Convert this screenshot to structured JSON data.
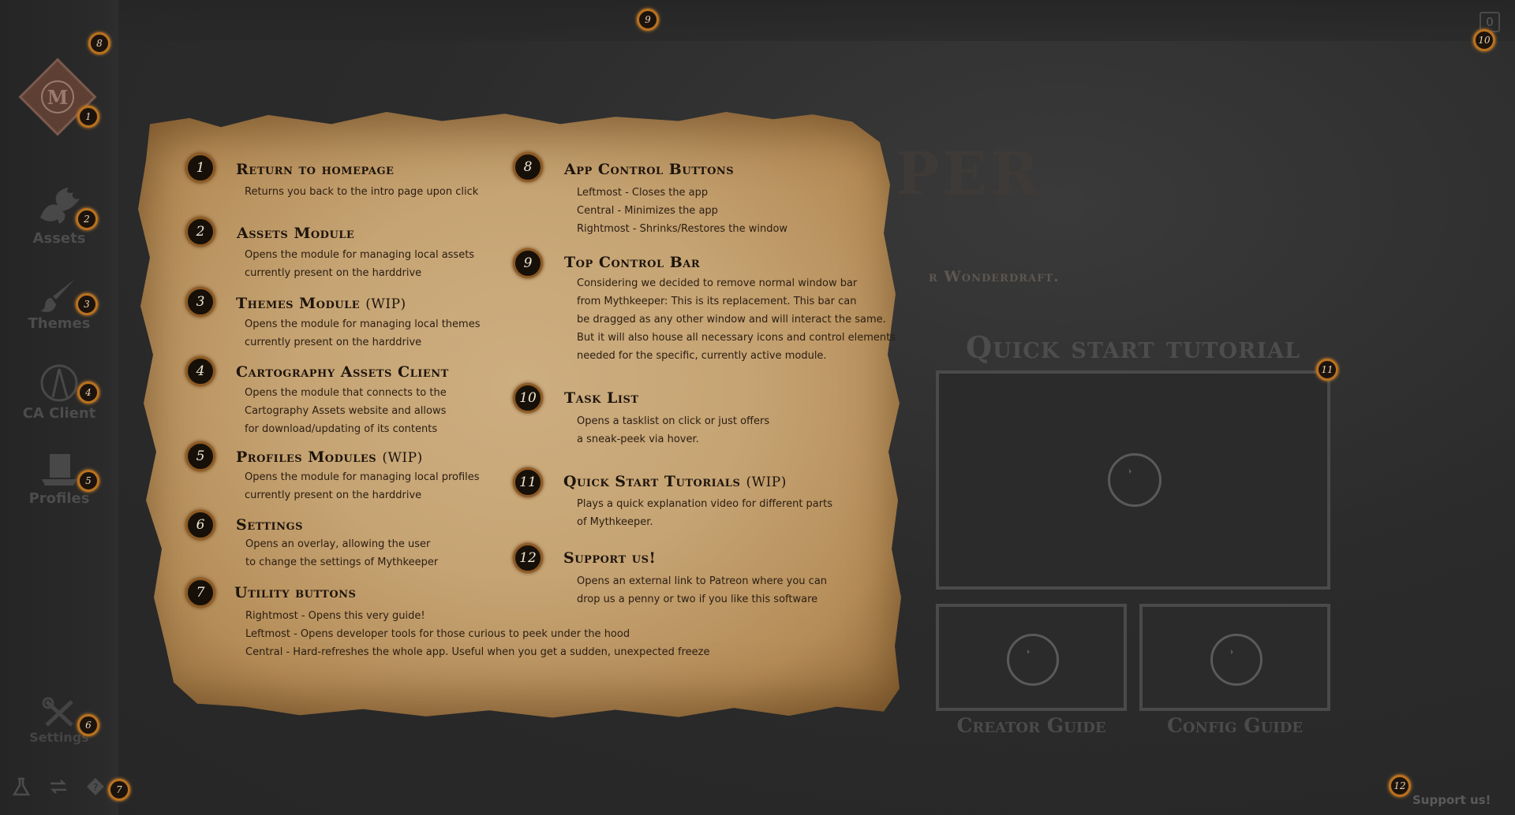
{
  "window_controls": {
    "close": "×",
    "minimize": "−",
    "restore": "⧉"
  },
  "task_count": "0",
  "logo_letter": "M",
  "sidebar": {
    "items": [
      {
        "label": "Assets",
        "icon": "dragon-icon"
      },
      {
        "label": "Themes",
        "icon": "brush-icon"
      },
      {
        "label": "CA Client",
        "icon": "compass-icon"
      },
      {
        "label": "Profiles",
        "icon": "top-hat-icon"
      }
    ],
    "settings_label": "Settings",
    "utility_icons": [
      "flask-icon",
      "refresh-icon",
      "help-diamond-icon"
    ]
  },
  "background": {
    "title_fragment": "PER",
    "subtitle_fragment": "r Wonderdraft.",
    "quick_start_title": "Quick start tutorial",
    "guides": [
      "Creator Guide",
      "Config Guide"
    ],
    "support_link": "Support us!"
  },
  "badges": [
    "1",
    "2",
    "3",
    "4",
    "5",
    "6",
    "7",
    "8",
    "9",
    "10",
    "11",
    "12"
  ],
  "guide": {
    "left": [
      {
        "num": "1",
        "title": "Return to homepage",
        "wip": "",
        "lines": [
          "Returns you back to the intro page upon click"
        ]
      },
      {
        "num": "2",
        "title": "Assets Module",
        "wip": "",
        "lines": [
          "Opens the module for managing local assets",
          "currently present on the harddrive"
        ]
      },
      {
        "num": "3",
        "title": "Themes Module",
        "wip": "(WIP)",
        "lines": [
          "Opens the module for managing local themes",
          "currently present on the harddrive"
        ]
      },
      {
        "num": "4",
        "title": "Cartography Assets Client",
        "wip": "",
        "lines": [
          "Opens the module that connects to the",
          "Cartography Assets website and allows",
          "for download/updating of its contents"
        ]
      },
      {
        "num": "5",
        "title": "Profiles Modules",
        "wip": "(WIP)",
        "lines": [
          "Opens the module for managing local profiles",
          "currently present on the harddrive"
        ]
      },
      {
        "num": "6",
        "title": "Settings",
        "wip": "",
        "lines": [
          "Opens an overlay, allowing the user",
          "to change the settings of Mythkeeper"
        ]
      },
      {
        "num": "7",
        "title": "Utility buttons",
        "wip": "",
        "lines": [
          "Rightmost - Opens this very guide!",
          "Leftmost - Opens developer tools for those curious to peek under the hood",
          "Central - Hard-refreshes the whole app. Useful when you get a sudden, unexpected freeze"
        ]
      }
    ],
    "right": [
      {
        "num": "8",
        "title": "App Control Buttons",
        "wip": "",
        "lines": [
          "Leftmost - Closes the app",
          "Central - Minimizes the app",
          "Rightmost - Shrinks/Restores the window"
        ]
      },
      {
        "num": "9",
        "title": "Top Control Bar",
        "wip": "",
        "lines": [
          "Considering we decided to remove normal window bar",
          "from Mythkeeper: This is its replacement. This bar can",
          "be dragged as any other window and will interact the same.",
          "But it will also house all necessary icons and control elements",
          "needed for the specific, currently active module."
        ]
      },
      {
        "num": "10",
        "title": "Task List",
        "wip": "",
        "lines": [
          "Opens a tasklist on click or just offers",
          "a sneak-peek via hover."
        ]
      },
      {
        "num": "11",
        "title": "Quick Start Tutorials",
        "wip": "(WIP)",
        "lines": [
          "Plays a quick explanation video for different parts",
          "of Mythkeeper."
        ]
      },
      {
        "num": "12",
        "title": "Support us!",
        "wip": "",
        "lines": [
          "Opens an external link to Patreon where you can",
          "drop us a penny or two if you like this software"
        ]
      }
    ]
  }
}
